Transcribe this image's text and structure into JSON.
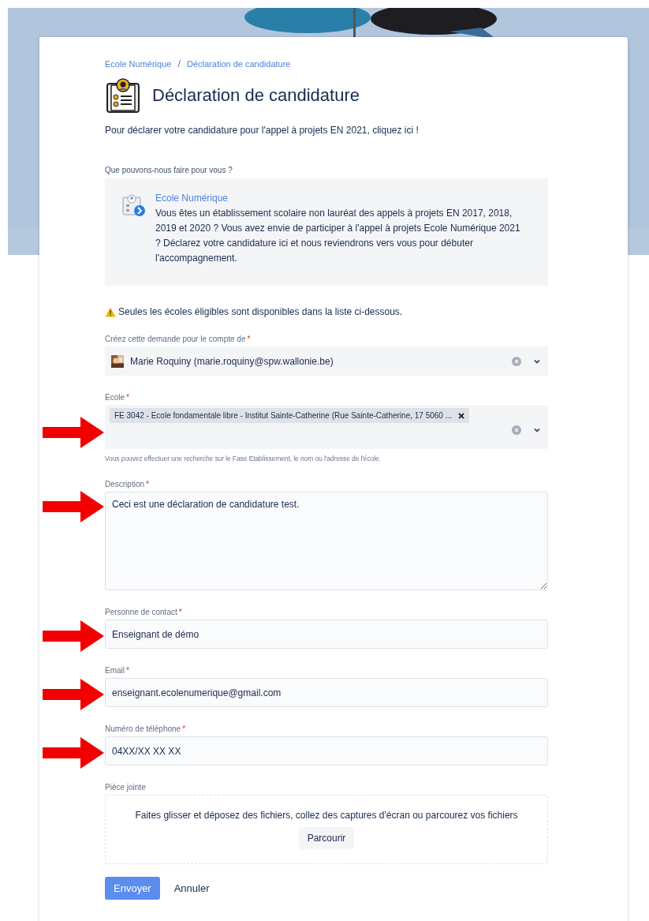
{
  "breadcrumb": [
    {
      "label": "Ecole Numérique"
    },
    {
      "label": "Déclaration de candidature"
    }
  ],
  "breadcrumb_separator": "/",
  "title": "Déclaration de candidature",
  "intro": "Pour déclarer votre candidature pour l'appel à projets EN 2021, cliquez ici !",
  "help_section": {
    "label": "Que pouvons-nous faire pour vous ?",
    "card": {
      "title": "Ecole Numérique",
      "text": "Vous êtes un établissement scolaire non lauréat des appels à projets EN 2017, 2018, 2019 et 2020 ? Vous avez envie de participer à l'appel à projets Ecole Numérique 2021 ? Déclarez votre candidature ici et nous reviendrons vers vous pour débuter l'accompagnement."
    }
  },
  "notice": "Seules les écoles éligibles sont disponibles dans la liste ci-dessous.",
  "fields": [
    {
      "kind": "user-select",
      "label": "Créez cette demande pour le compte de",
      "required_mark": "*",
      "value": "Marie Roquiny (marie.roquiny@spw.wallonie.be)",
      "annotated": false
    },
    {
      "kind": "tag-select",
      "label": "Ecole",
      "required_mark": "*",
      "tags": [
        {
          "label": "FE 3042 - Ecole fondamentale libre - Institut Sainte-Catherine (Rue Sainte-Catherine, 17 5060 ..."
        }
      ],
      "help": "Vous pouvez effectuer une recherche sur le Fase Etablissement, le nom ou l'adresse de l'école.",
      "annotated": true
    },
    {
      "kind": "textarea",
      "label": "Description",
      "required_mark": "*",
      "value": "Ceci est une déclaration de candidature test.",
      "annotated": true
    },
    {
      "kind": "text",
      "label": "Personne de contact",
      "required_mark": "*",
      "value": "Enseignant de démo",
      "annotated": true
    },
    {
      "kind": "text",
      "label": "Email",
      "required_mark": "*",
      "value": "enseignant.ecolenumerique@gmail.com",
      "annotated": true
    },
    {
      "kind": "text",
      "label": "Numéro de téléphone",
      "required_mark": "*",
      "value": "04XX/XX XX XX",
      "annotated": true
    }
  ],
  "attachment": {
    "label": "Pièce jointe",
    "prompt": "Faites glisser et déposez des fichiers, collez des captures d'écran ou parcourez vos fichiers",
    "button": "Parcourir"
  },
  "actions": [
    {
      "kind": "primary",
      "label": "Envoyer"
    },
    {
      "kind": "link",
      "label": "Annuler"
    }
  ]
}
